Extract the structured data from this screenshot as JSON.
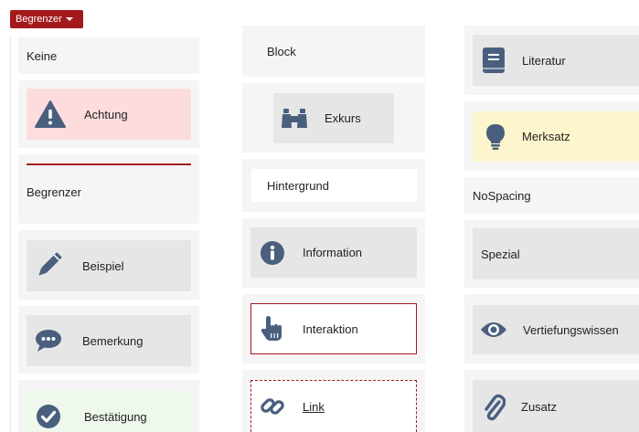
{
  "dropdown": {
    "label": "Begrenzer"
  },
  "tiles": {
    "keine": "Keine",
    "achtung": "Achtung",
    "begrenzer": "Begrenzer",
    "beispiel": "Beispiel",
    "bemerkung": "Bemerkung",
    "bestaetigung": "Bestätigung",
    "block": "Block",
    "exkurs": "Exkurs",
    "hintergrund": "Hintergrund",
    "information": "Information",
    "interaktion": "Interaktion",
    "link": "Link",
    "literatur": "Literatur",
    "merksatz": "Merksatz",
    "nospacing": "NoSpacing",
    "spezial": "Spezial",
    "vertiefungswissen": "Vertiefungswissen",
    "zusatz": "Zusatz"
  },
  "colors": {
    "accent": "#a3191c",
    "icon": "#4a5f7e",
    "tile_bg": "#f5f5f5",
    "achtung_bg": "#fddcdd",
    "merksatz_bg": "#fdf6cc",
    "bestaetigung_bg": "#eef8ec",
    "inner_gray": "#e6e6e6"
  },
  "icons": {
    "achtung": "warning-icon",
    "beispiel": "pencil-icon",
    "bemerkung": "comment-icon",
    "bestaetigung": "check-circle-icon",
    "exkurs": "binoculars-icon",
    "information": "info-icon",
    "interaktion": "hand-pointer-icon",
    "link": "link-icon",
    "literatur": "book-icon",
    "merksatz": "lightbulb-icon",
    "vertiefungswissen": "eye-icon",
    "zusatz": "paperclip-icon"
  }
}
